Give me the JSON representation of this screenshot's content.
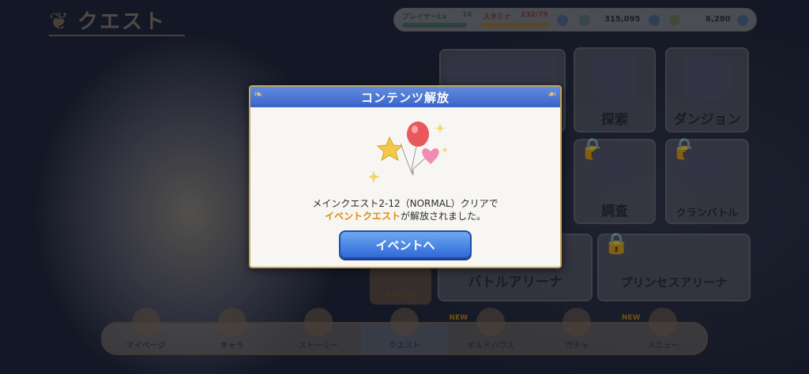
{
  "header": {
    "title": "クエスト",
    "player_label": "プレイヤーLv",
    "level": "16",
    "stamina_label": "スタミナ",
    "stamina": "232/79",
    "mana": "315,095",
    "jewels": "8,280"
  },
  "menu": {
    "explore": "探索",
    "dungeon": "ダンジョン",
    "survey": "調査",
    "clan_battle": "クランバトル",
    "battle_arena": "バトルアリーナ",
    "princess_arena": "プリンセスアリーナ",
    "event": "イベント"
  },
  "bottom_nav": [
    {
      "label": "マイページ",
      "new": ""
    },
    {
      "label": "キャラ",
      "new": ""
    },
    {
      "label": "ストーリー",
      "new": ""
    },
    {
      "label": "クエスト",
      "new": ""
    },
    {
      "label": "ギルドハウス",
      "new": "NEW"
    },
    {
      "label": "ガチャ",
      "new": ""
    },
    {
      "label": "メニュー",
      "new": "NEW"
    }
  ],
  "modal": {
    "title": "コンテンツ解放",
    "message_line1": "メインクエスト2-12（NORMAL）クリアで",
    "message_highlight": "イベントクエスト",
    "message_line2_rest": "が解放されました。",
    "button_label": "イベントへ"
  },
  "colors": {
    "header_blue": "#3a63c9",
    "button_blue": "#2f6ad8",
    "highlight_orange": "#e08a10",
    "gold_border": "#c7a55c"
  }
}
